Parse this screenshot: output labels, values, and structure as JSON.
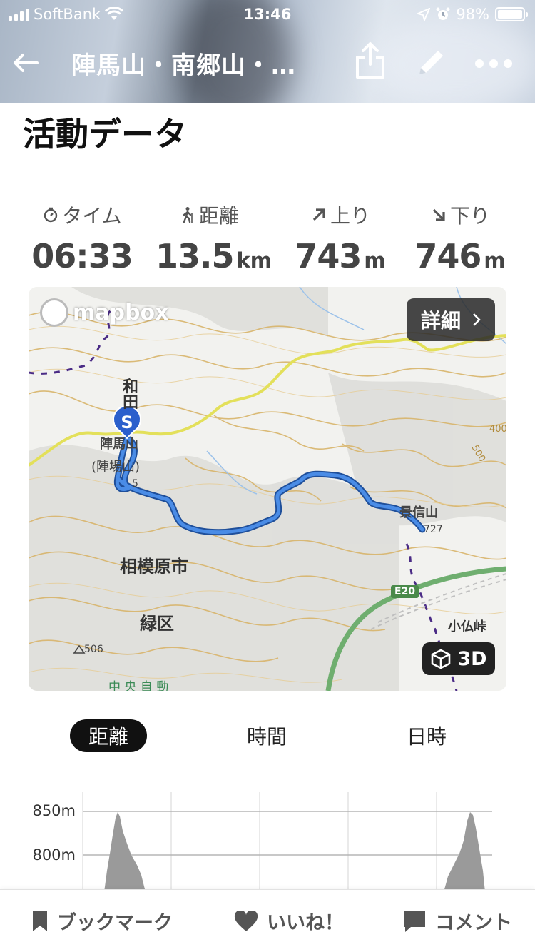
{
  "status_bar": {
    "carrier": "SoftBank",
    "time": "13:46",
    "battery": "98%"
  },
  "nav": {
    "title": "陣馬山・南郷山・…"
  },
  "section_title": "活動データ",
  "stats": [
    {
      "label": "タイム",
      "value": "06:33",
      "unit": ""
    },
    {
      "label": "距離",
      "value": "13.5",
      "unit": "km"
    },
    {
      "label": "上り",
      "value": "743",
      "unit": "m"
    },
    {
      "label": "下り",
      "value": "746",
      "unit": "m"
    }
  ],
  "map": {
    "attribution": "mapbox",
    "detail_label": "詳細",
    "button_3d": "3D",
    "start_marker": "S",
    "route_color": "#3a78d6",
    "labels": {
      "wada": "和田",
      "jinbasan": "陣馬山",
      "jinbasan_alt": "(陣場山)",
      "kagenobu": "景信山",
      "sagamihara": "相模原市",
      "midori": "緑区",
      "kobotoke": "小仏峠",
      "h727": "727",
      "h506": "506",
      "h400": "400",
      "h500": "500",
      "h855": "5",
      "e20": "E20",
      "chuo": "中 央 自 動"
    }
  },
  "tabs": {
    "distance": "距離",
    "time": "時間",
    "datetime": "日時",
    "active": "距離"
  },
  "elevation": {
    "ticks": [
      "850m",
      "800m"
    ]
  },
  "bottom_bar": {
    "bookmark": "ブックマーク",
    "like": "いいね！",
    "comment": "コメント"
  }
}
